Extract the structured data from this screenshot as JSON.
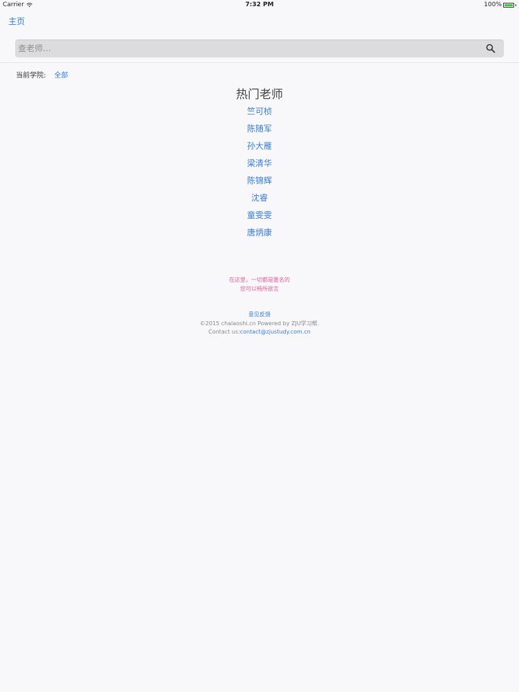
{
  "status_bar": {
    "carrier": "Carrier",
    "time": "7:32 PM",
    "battery": "100%"
  },
  "nav": {
    "back_label": "主页"
  },
  "search": {
    "placeholder": "查老师..."
  },
  "college": {
    "label": "当前学院:",
    "value": "全部"
  },
  "hot": {
    "title": "热门老师",
    "teachers": [
      "竺可桢",
      "陈随军",
      "孙大雁",
      "梁清华",
      "陈锦辉",
      "沈睿",
      "童雯雯",
      "唐炳康"
    ]
  },
  "notice": {
    "line1": "在这里，一切都是匿名的",
    "line2": "您可以畅所欲言"
  },
  "footer": {
    "feedback": "意见反馈",
    "copyright": "©2015 chalaoshi.cn Powered by ZJU学习帮.",
    "contact_label": "Contact us:",
    "contact_email": "contact@zjustudy.com.cn"
  },
  "colors": {
    "link": "#3a7ccf",
    "notice": "#e0609a"
  },
  "icons": [
    "wifi-icon",
    "battery-icon",
    "search-icon"
  ]
}
